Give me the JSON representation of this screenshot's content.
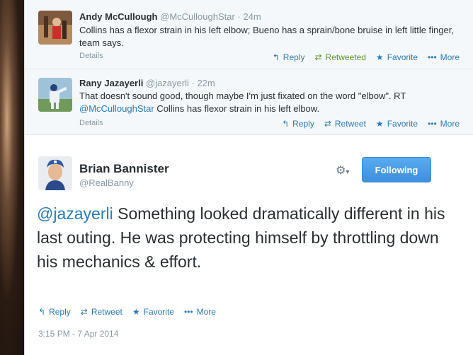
{
  "tweets": [
    {
      "name": "Andy McCullough",
      "handle": "@McCulloughStar",
      "time": "24m",
      "text": "Collins has a flexor strain in his left elbow; Bueno has a sprain/bone bruise in left little finger, team says.",
      "details": "Details",
      "actions": {
        "reply": "Reply",
        "retweet": "Retweeted",
        "favorite": "Favorite",
        "more": "More"
      }
    },
    {
      "name": "Rany Jazayerli",
      "handle": "@jazayerli",
      "time": "22m",
      "text_before": "That doesn't sound good, though maybe I'm just fixated on the word \"elbow\". RT ",
      "mention": "@McCulloughStar",
      "text_after": " Collins has flexor strain in his left elbow.",
      "details": "Details",
      "actions": {
        "reply": "Reply",
        "retweet": "Retweet",
        "favorite": "Favorite",
        "more": "More"
      }
    }
  ],
  "main": {
    "name": "Brian Bannister",
    "handle": "@RealBanny",
    "follow_label": "Following",
    "mention": "@jazayerli",
    "text": " Something looked dramatically different in his last outing. He was protecting himself by throttling down his mechanics & effort.",
    "actions": {
      "reply": "Reply",
      "retweet": "Retweet",
      "favorite": "Favorite",
      "more": "More"
    },
    "timestamp": "3:15 PM - 7 Apr 2014"
  },
  "icons": {
    "reply": "reply-arrow-icon",
    "retweet": "retweet-icon",
    "favorite": "star-icon",
    "more": "more-dots-icon",
    "gear": "gear-icon"
  },
  "colors": {
    "link": "#2b7bb9",
    "retweeted": "#609928",
    "follow_button": "#4a9ee9",
    "muted": "#8899a6"
  }
}
